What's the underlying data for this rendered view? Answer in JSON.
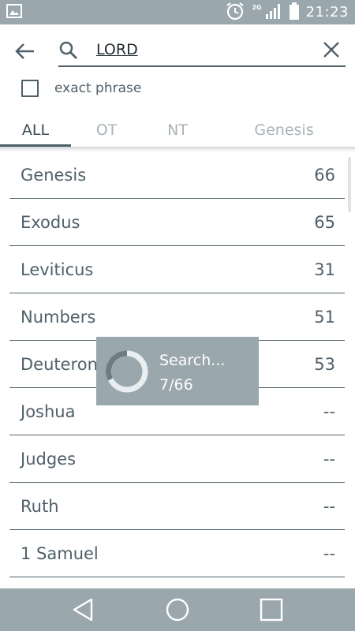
{
  "status_bar": {
    "time": "21:23",
    "network_label": "2G",
    "icons": [
      "image-icon",
      "alarm-icon",
      "signal-icon",
      "battery-icon"
    ]
  },
  "search": {
    "query": "LORD",
    "placeholder": ""
  },
  "options": {
    "exact_phrase_label": "exact phrase",
    "exact_phrase_checked": false
  },
  "tabs": [
    {
      "label": "ALL",
      "active": true
    },
    {
      "label": "OT",
      "active": false
    },
    {
      "label": "NT",
      "active": false
    },
    {
      "label": "Genesis",
      "active": false
    }
  ],
  "books": [
    {
      "name": "Genesis",
      "count": "66"
    },
    {
      "name": "Exodus",
      "count": "65"
    },
    {
      "name": "Leviticus",
      "count": "31"
    },
    {
      "name": "Numbers",
      "count": "51"
    },
    {
      "name": "Deuteronomy",
      "count": "53"
    },
    {
      "name": "Joshua",
      "count": "--"
    },
    {
      "name": "Judges",
      "count": "--"
    },
    {
      "name": "Ruth",
      "count": "--"
    },
    {
      "name": "1 Samuel",
      "count": "--"
    }
  ],
  "progress": {
    "title": "Search...",
    "count": "7/66"
  },
  "colors": {
    "bar": "#9aa7ac",
    "text": "#4f6069",
    "inactive_tab": "#a9b3b8"
  }
}
